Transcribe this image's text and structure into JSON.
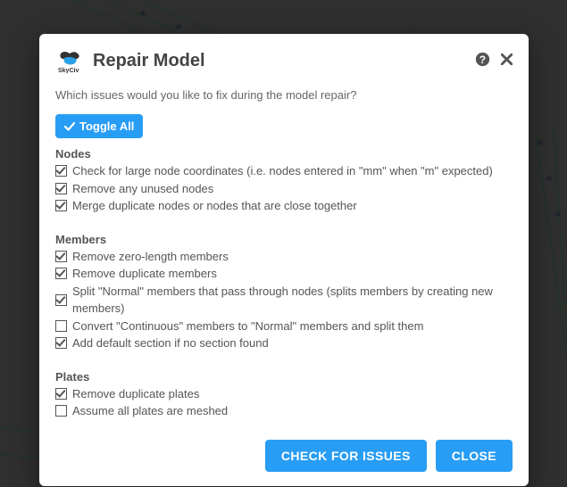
{
  "brand": "SkyCiv",
  "title": "Repair Model",
  "prompt": "Which issues would you like to fix during the model repair?",
  "toggle_label": "Toggle All",
  "sections": {
    "nodes": {
      "heading": "Nodes",
      "items": [
        {
          "label": "Check for large node coordinates (i.e. nodes entered in \"mm\" when \"m\" expected)",
          "checked": true
        },
        {
          "label": "Remove any unused nodes",
          "checked": true
        },
        {
          "label": "Merge duplicate nodes or nodes that are close together",
          "checked": true
        }
      ]
    },
    "members": {
      "heading": "Members",
      "items": [
        {
          "label": "Remove zero-length members",
          "checked": true
        },
        {
          "label": "Remove duplicate members",
          "checked": true
        },
        {
          "label": "Split \"Normal\" members that pass through nodes (splits members by creating new members)",
          "checked": true
        },
        {
          "label": "Convert \"Continuous\" members to \"Normal\" members and split them",
          "checked": false
        },
        {
          "label": "Add default section if no section found",
          "checked": true
        }
      ]
    },
    "plates": {
      "heading": "Plates",
      "items": [
        {
          "label": "Remove duplicate plates",
          "checked": true
        },
        {
          "label": "Assume all plates are meshed",
          "checked": false
        }
      ]
    }
  },
  "buttons": {
    "check": "CHECK FOR ISSUES",
    "close": "CLOSE"
  },
  "bg_labels": {
    "top": "3",
    "right": "28"
  }
}
